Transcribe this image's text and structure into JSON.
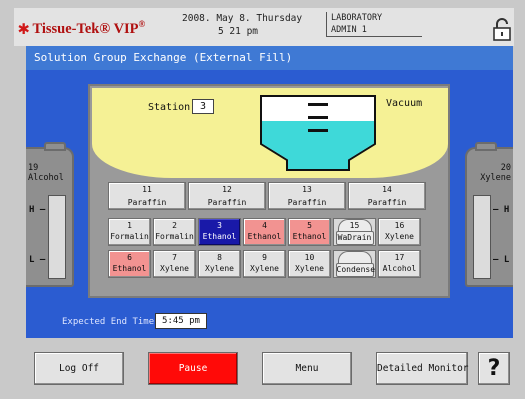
{
  "header": {
    "logo_text": "Tissue-Tek",
    "logo_suffix": "VIP",
    "logo_reg": "®",
    "date": "2008. May 8. Thursday",
    "time": "5 21 pm",
    "department": "LABORATORY",
    "user": "ADMIN 1",
    "lock_icon": "lock-icon"
  },
  "title": "Solution Group Exchange (External Fill)",
  "retort": {
    "station_label": "Station",
    "station_value": "3",
    "status": "Vacuum",
    "liquid_level_fraction": 0.5,
    "liquid_color": "#3ed9d9"
  },
  "paraffin_row": [
    {
      "num": "11",
      "label": "Paraffin"
    },
    {
      "num": "12",
      "label": "Paraffin"
    },
    {
      "num": "13",
      "label": "Paraffin"
    },
    {
      "num": "14",
      "label": "Paraffin"
    }
  ],
  "reagent_row_1": [
    {
      "num": "1",
      "label": "Formalin"
    },
    {
      "num": "2",
      "label": "Formalin"
    },
    {
      "num": "3",
      "label": "Ethanol"
    },
    {
      "num": "4",
      "label": "Ethanol"
    },
    {
      "num": "5",
      "label": "Ethanol"
    },
    {
      "num": "15",
      "label": "WaDrain"
    },
    {
      "num": "16",
      "label": "Xylene"
    }
  ],
  "reagent_row_2": [
    {
      "num": "6",
      "label": "Ethanol"
    },
    {
      "num": "7",
      "label": "Xylene"
    },
    {
      "num": "8",
      "label": "Xylene"
    },
    {
      "num": "9",
      "label": "Xylene"
    },
    {
      "num": "10",
      "label": "Xylene"
    },
    {
      "num": "",
      "label": "Condense"
    },
    {
      "num": "17",
      "label": "Alcohol"
    }
  ],
  "left_bottle": {
    "num": "19",
    "label": "Alcohol",
    "high": "H",
    "low": "L"
  },
  "right_bottle": {
    "num": "20",
    "label": "Xylene",
    "high": "H",
    "low": "L"
  },
  "expected_end": {
    "label": "Expected End Time",
    "value": "5:45 pm"
  },
  "buttons": {
    "log_off": "Log Off",
    "pause": "Pause",
    "menu": "Menu",
    "detailed_monitor": "Detailed Monitor",
    "help": "?"
  },
  "colors": {
    "title_bar": "#3f79d4",
    "panel_blue": "#2b5cd1",
    "retort_yellow": "#f5f195",
    "selected": "#1919a8",
    "active_pink": "#f29391",
    "pause_red": "#ff0a08"
  }
}
